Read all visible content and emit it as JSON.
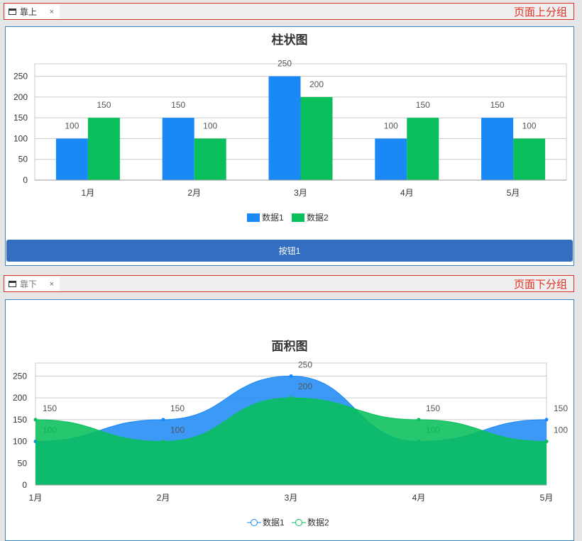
{
  "top_group": {
    "tab_label": "靠上",
    "close_glyph": "×",
    "title": "页面上分组",
    "button_label": "按钮1"
  },
  "bottom_group": {
    "tab_label": "靠下",
    "close_glyph": "×",
    "title": "页面下分组"
  },
  "chart_data": [
    {
      "type": "bar",
      "title": "柱状图",
      "categories": [
        "1月",
        "2月",
        "3月",
        "4月",
        "5月"
      ],
      "series": [
        {
          "name": "数据1",
          "values": [
            100,
            150,
            250,
            100,
            150
          ],
          "color": "#1a88f5"
        },
        {
          "name": "数据2",
          "values": [
            150,
            100,
            200,
            150,
            100
          ],
          "color": "#08bf5b"
        }
      ],
      "ylim": [
        0,
        280
      ],
      "yticks": [
        0,
        50,
        100,
        150,
        200,
        250
      ],
      "grid": true,
      "legend": "bottom-center"
    },
    {
      "type": "area",
      "title": "面积图",
      "categories": [
        "1月",
        "2月",
        "3月",
        "4月",
        "5月"
      ],
      "series": [
        {
          "name": "数据1",
          "values": [
            100,
            150,
            250,
            100,
            150
          ],
          "color": "#1a88f5"
        },
        {
          "name": "数据2",
          "values": [
            150,
            100,
            200,
            150,
            100
          ],
          "color": "#08bf5b"
        }
      ],
      "ylim": [
        0,
        280
      ],
      "yticks": [
        0,
        50,
        100,
        150,
        200,
        250
      ],
      "grid": true,
      "legend": "bottom-center"
    }
  ]
}
